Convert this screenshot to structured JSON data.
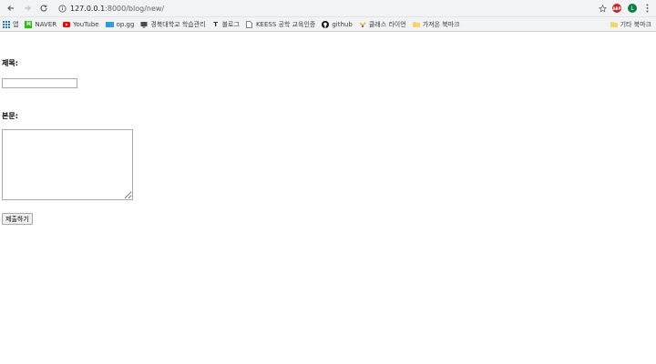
{
  "browser": {
    "url_prefix": "127.0.0.1",
    "url_rest": ":8000/blog/new/"
  },
  "bookmarks": [
    {
      "label": "앱",
      "icon": "apps-grid-icon"
    },
    {
      "label": "NAVER",
      "icon": "naver-icon"
    },
    {
      "label": "YouTube",
      "icon": "youtube-icon"
    },
    {
      "label": "op.gg",
      "icon": "opgg-icon"
    },
    {
      "label": "경북대학교 학습관리",
      "icon": "monitor-icon"
    },
    {
      "label": "블로그",
      "icon": "tistory-icon"
    },
    {
      "label": "KEESS 공학 교육인증",
      "icon": "page-icon"
    },
    {
      "label": "github",
      "icon": "github-icon"
    },
    {
      "label": "클래스 라이언",
      "icon": "class-icon"
    },
    {
      "label": "가져온 북마크",
      "icon": "folder-icon"
    }
  ],
  "other_bookmarks": {
    "label": "기타 북마크",
    "icon": "folder-icon"
  },
  "form": {
    "title_label": "제목:",
    "title_value": "",
    "body_label": "본문:",
    "body_value": "",
    "submit_label": "제출하기"
  },
  "profile": {
    "initial": "L"
  },
  "extension": {
    "label": "ABP"
  }
}
